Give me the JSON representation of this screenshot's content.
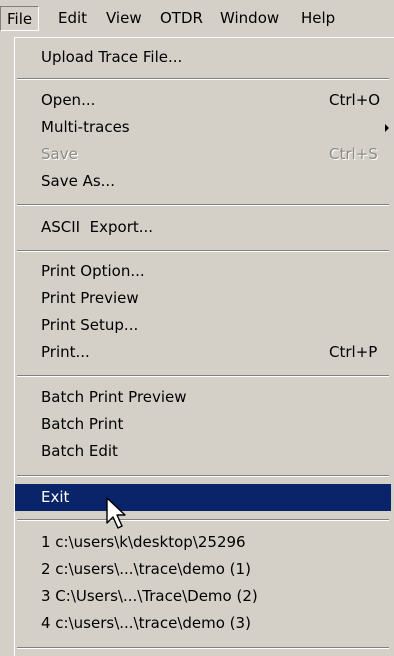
{
  "menubar": {
    "items": [
      {
        "label": "File"
      },
      {
        "label": "Edit"
      },
      {
        "label": "View"
      },
      {
        "label": "OTDR"
      },
      {
        "label": "Window"
      },
      {
        "label": "Help"
      }
    ],
    "active": "File"
  },
  "file_menu": {
    "upload_trace": {
      "label": "Upload Trace File..."
    },
    "open": {
      "label": "Open...",
      "shortcut": "Ctrl+O"
    },
    "multi_traces": {
      "label": "Multi-traces"
    },
    "save": {
      "label": "Save",
      "shortcut": "Ctrl+S"
    },
    "save_as": {
      "label": "Save As..."
    },
    "ascii_export": {
      "label": "ASCII  Export..."
    },
    "print_option": {
      "label": "Print Option..."
    },
    "print_preview": {
      "label": "Print Preview"
    },
    "print_setup": {
      "label": "Print Setup..."
    },
    "print": {
      "label": "Print...",
      "shortcut": "Ctrl+P"
    },
    "batch_print_preview": {
      "label": "Batch Print Preview"
    },
    "batch_print": {
      "label": "Batch Print"
    },
    "batch_edit": {
      "label": "Batch Edit"
    },
    "exit": {
      "label": "Exit"
    },
    "recent_files": [
      {
        "label": "1 c:\\users\\k\\desktop\\25296"
      },
      {
        "label": "2 c:\\users\\...\\trace\\demo (1)"
      },
      {
        "label": "3 C:\\Users\\...\\Trace\\Demo (2)"
      },
      {
        "label": "4 c:\\users\\...\\trace\\demo (3)"
      }
    ]
  },
  "state": {
    "highlighted_item": "Exit",
    "disabled_items": [
      "Save"
    ]
  },
  "colors": {
    "menu_background": "#d4d0c8",
    "highlight_background": "#0a246a",
    "highlight_text": "#ffffff",
    "disabled_text": "#8c8a84"
  }
}
